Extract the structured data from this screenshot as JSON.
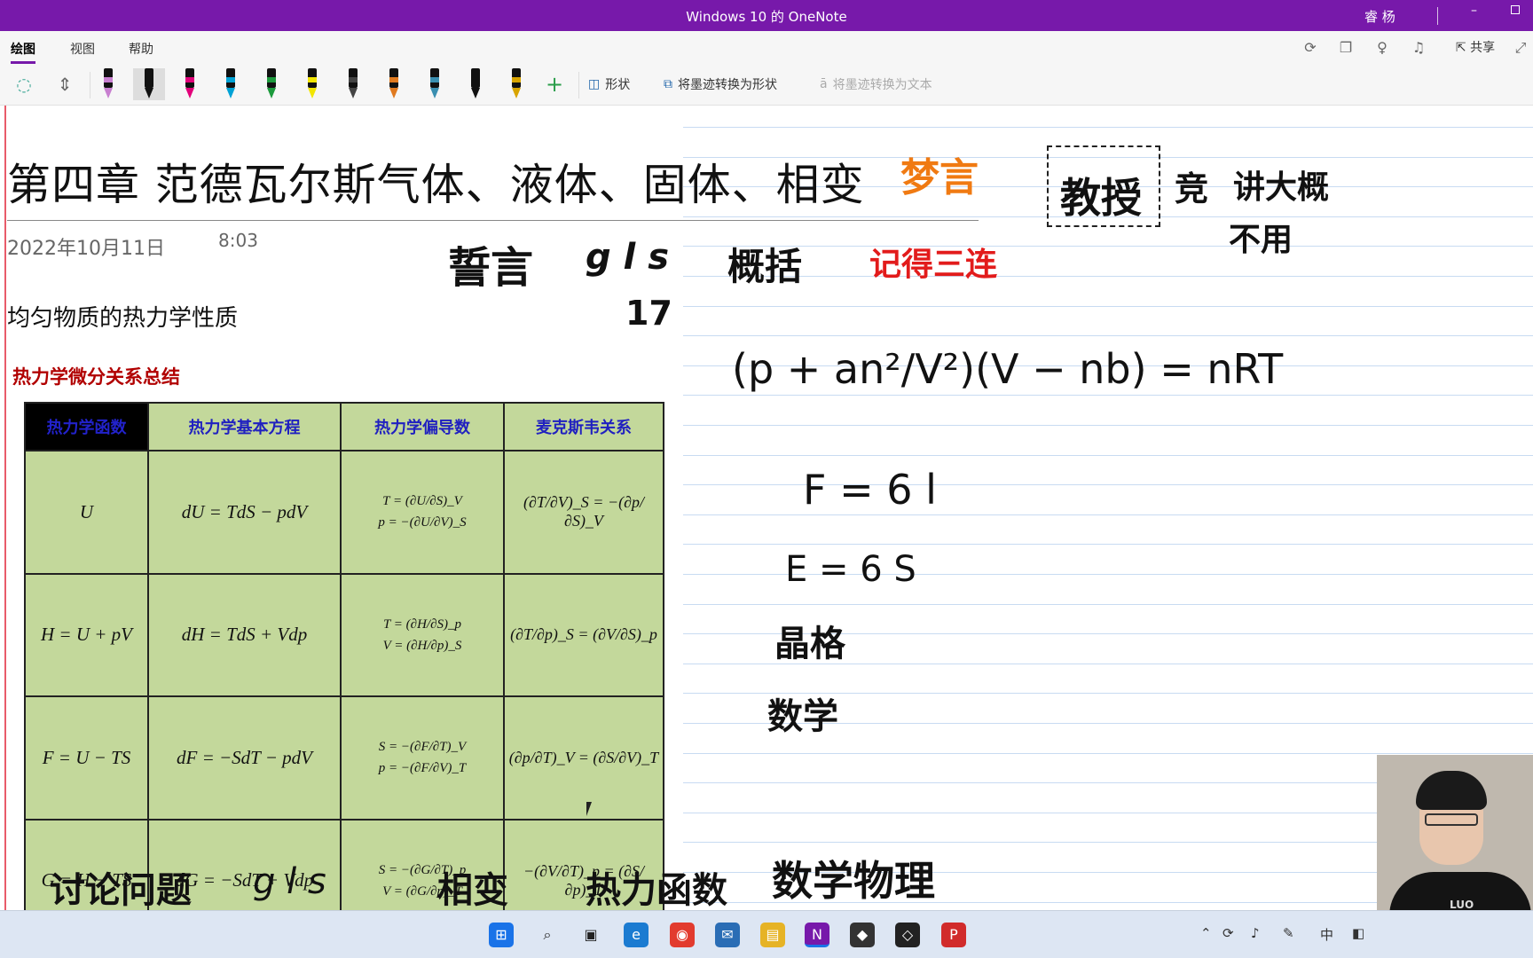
{
  "window": {
    "title": "Windows 10 的 OneNote",
    "user": "睿 杨",
    "minimize": "–"
  },
  "ribbon": {
    "tabs": [
      "绘图",
      "视图",
      "帮助"
    ],
    "share_label": "共享",
    "shape_label": "形状",
    "ink_to_shape_label": "将墨迹转换为形状",
    "ink_to_text_label": "将墨迹转换为文本",
    "add_pen_label": "+",
    "pens": [
      {
        "name": "highlighter-pink",
        "color": "#c87fd0"
      },
      {
        "name": "pen-black",
        "color": "#111111"
      },
      {
        "name": "pen-magenta",
        "color": "#e3007a"
      },
      {
        "name": "pen-cyan",
        "color": "#00a2d6"
      },
      {
        "name": "pen-green",
        "color": "#1c9a3c"
      },
      {
        "name": "highlighter-yellow",
        "color": "#f2e600"
      },
      {
        "name": "pen-galaxy",
        "color": "#444444"
      },
      {
        "name": "pen-rainbow",
        "color": "#e07a1f"
      },
      {
        "name": "pen-ocean",
        "color": "#3a8fb0"
      },
      {
        "name": "pen-dark",
        "color": "#111111"
      },
      {
        "name": "pen-gold",
        "color": "#d8a400"
      }
    ]
  },
  "page": {
    "title": "第四章 范德瓦尔斯气体、液体、固体、相变",
    "date": "2022年10月11日",
    "time": "8:03",
    "heading": "均匀物质的热力学性质",
    "table_title": "热力学微分关系总结",
    "table": {
      "headers": [
        "热力学函数",
        "热力学基本方程",
        "热力学偏导数",
        "麦克斯韦关系"
      ],
      "rows": [
        {
          "fn": "U",
          "eq": "dU = TdS − pdV",
          "pd1": "T = (∂U/∂S)_V",
          "pd2": "p = −(∂U/∂V)_S",
          "mx": "(∂T/∂V)_S = −(∂p/∂S)_V"
        },
        {
          "fn": "H = U + pV",
          "eq": "dH = TdS + Vdp",
          "pd1": "T = (∂H/∂S)_p",
          "pd2": "V = (∂H/∂p)_S",
          "mx": "(∂T/∂p)_S = (∂V/∂S)_p"
        },
        {
          "fn": "F = U − TS",
          "eq": "dF = −SdT − pdV",
          "pd1": "S = −(∂F/∂T)_V",
          "pd2": "p = −(∂F/∂V)_T",
          "mx": "(∂p/∂T)_V = (∂S/∂V)_T"
        },
        {
          "fn": "G = H − TS",
          "eq": "dG = −SdT + Vdp",
          "pd1": "S = −(∂G/∂T)_p",
          "pd2": "V = (∂G/∂p)_T",
          "mx": "−(∂V/∂T)_p = (∂S/∂p)_T"
        }
      ]
    },
    "ink": {
      "mengyan": "梦言",
      "jiaoshou": "教授",
      "jing": "竞",
      "jiangdagai": "讲大概",
      "buyong": "不用",
      "shiyan": "誓言",
      "gls": "g l s",
      "num17": "17",
      "gaikuo": "概括",
      "sanlian": "记得三连",
      "vdw": "(p + an²/V²)(V − nb) = nRT",
      "f6l": "F = 6 l",
      "e6s": "E = 6 S",
      "jingge": "晶格",
      "shuxue": "数学",
      "bottom": [
        "讨论问题",
        "g l s",
        "相变",
        "热力函数",
        "数学物理"
      ]
    }
  },
  "taskbar": {
    "tray_ime": "中"
  }
}
